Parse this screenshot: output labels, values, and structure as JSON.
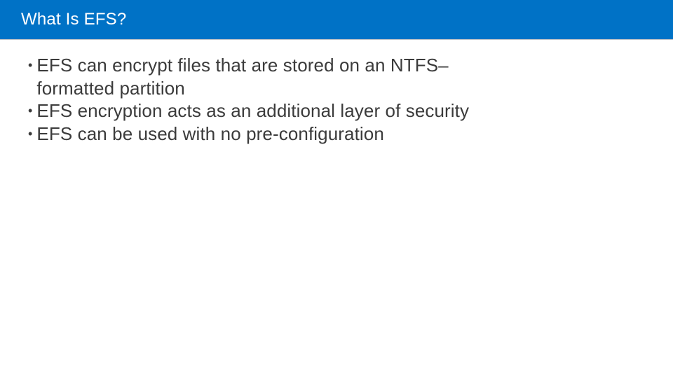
{
  "title": "What Is EFS?",
  "bullets": [
    "EFS can encrypt files that are stored on an NTFS–formatted partition",
    "EFS encryption acts as an additional layer of security",
    "EFS can be used with no pre-configuration"
  ],
  "theme": {
    "accent": "#0072c6",
    "text": "#3b3b3b",
    "background": "#ffffff"
  }
}
